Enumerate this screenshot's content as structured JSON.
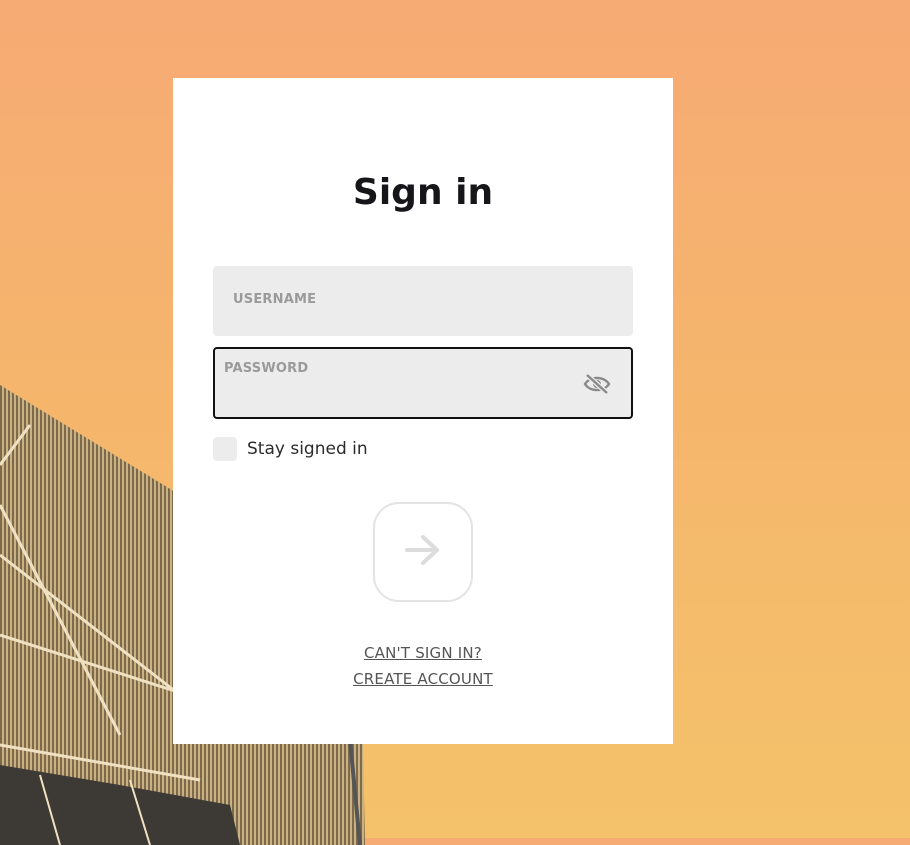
{
  "form": {
    "title": "Sign in",
    "username_label": "USERNAME",
    "password_label": "PASSWORD",
    "stay_signed_in_label": "Stay signed in",
    "cant_sign_in_link": "CAN'T SIGN IN?",
    "create_account_link": "CREATE ACCOUNT"
  },
  "icons": {
    "password_toggle": "eye-slash-icon",
    "submit": "arrow-right-icon"
  },
  "colors": {
    "background_top": "#f6aa74",
    "background_bottom": "#f4c26a",
    "card": "#ffffff",
    "field_fill": "#ececec",
    "title_text": "#16161a"
  }
}
